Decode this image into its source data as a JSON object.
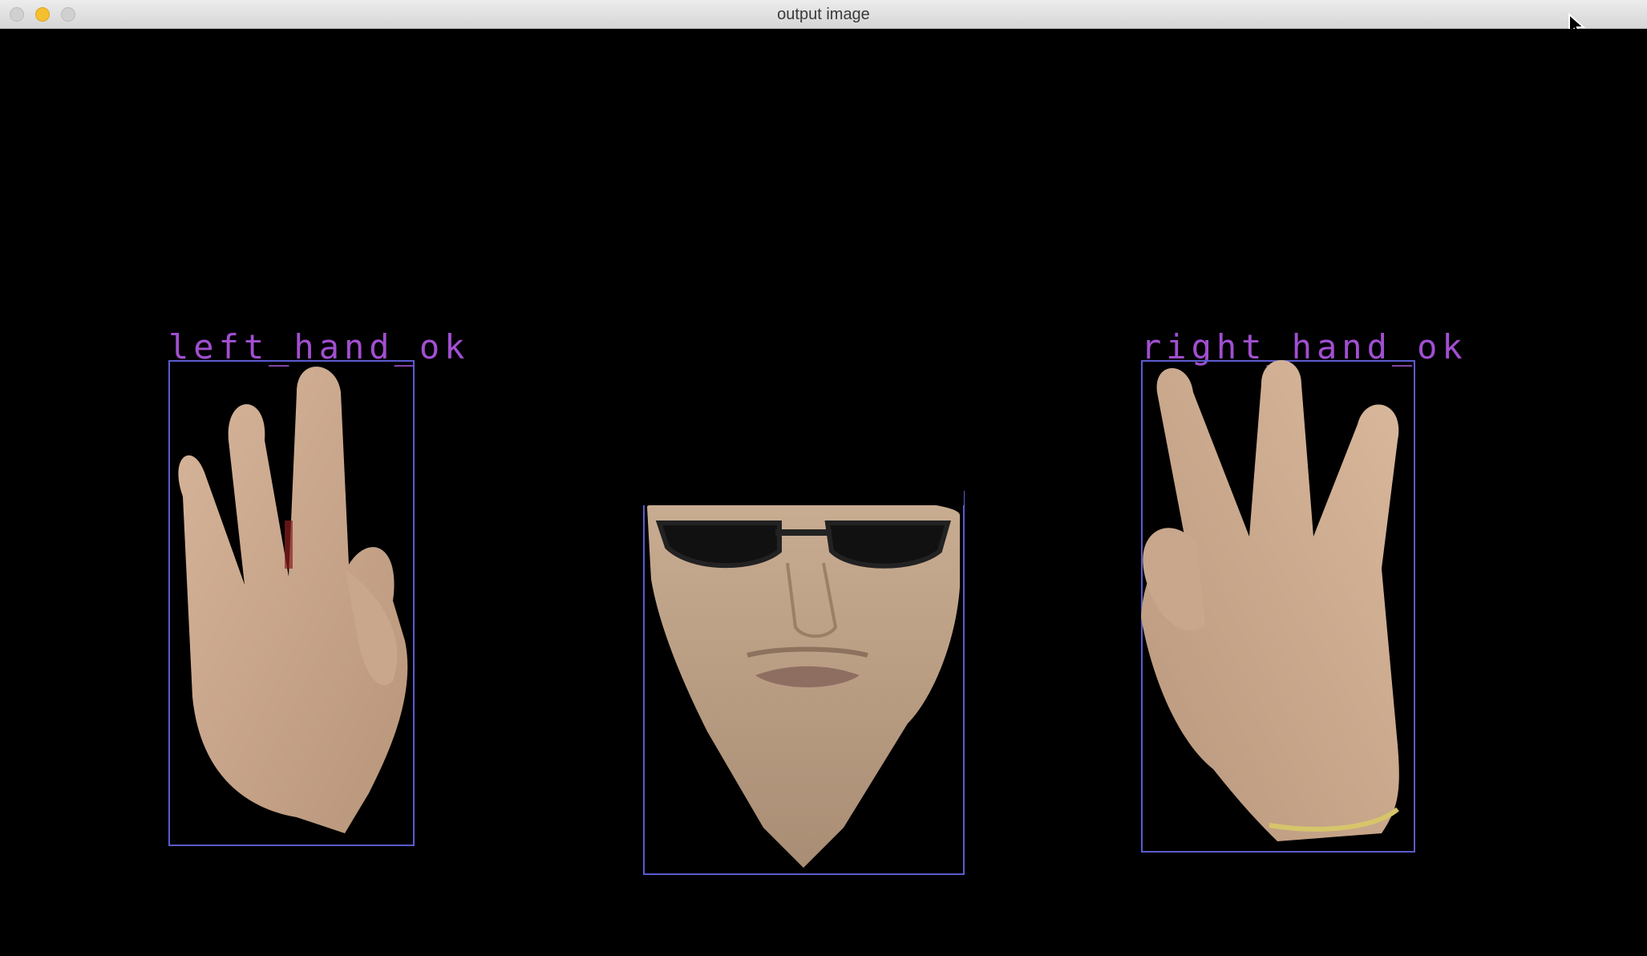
{
  "window": {
    "title": "output image"
  },
  "detections": [
    {
      "label": "left_hand_ok"
    },
    {
      "label": "face"
    },
    {
      "label": "right_hand_ok"
    }
  ],
  "colors": {
    "background": "#000000",
    "box": "#5b5bd0",
    "label": "#a14fd1",
    "skin": "#c9a98c"
  }
}
